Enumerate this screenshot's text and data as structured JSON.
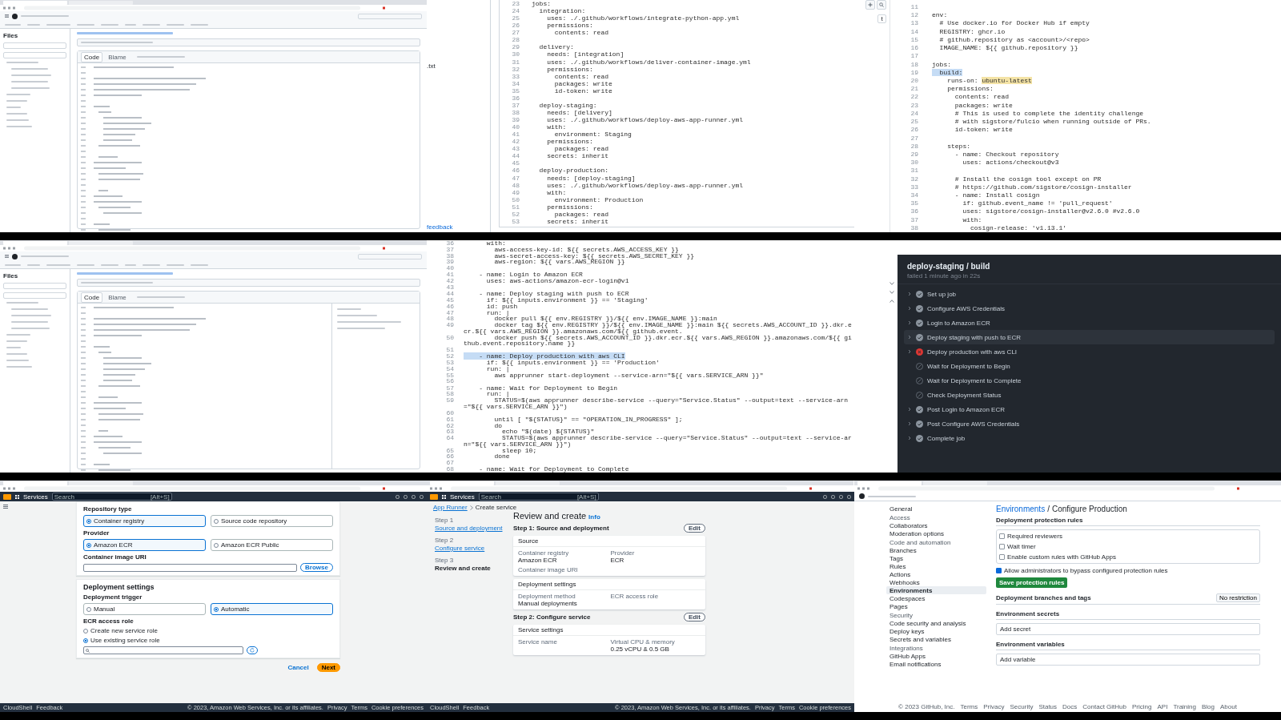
{
  "frames": [
    {
      "kind": "github-file",
      "files_label": "Files",
      "tabs": [
        {
          "label": "Code",
          "selected": true
        },
        {
          "label": "Blame",
          "selected": false
        }
      ],
      "symbols_panel": false
    },
    {
      "kind": "code",
      "sidebar": {
        "kind": "files",
        "texts": [
          ".txt"
        ],
        "link": "feedback"
      },
      "lines": [
        {
          "n": "23",
          "text": "jobs:",
          "selected": false
        },
        {
          "n": "24",
          "text": "  integration:",
          "selected": false
        },
        {
          "n": "25",
          "text": "    uses: ./.github/workflows/integrate-python-app.yml",
          "selected": false
        },
        {
          "n": "26",
          "text": "    permissions:",
          "selected": false
        },
        {
          "n": "27",
          "text": "      contents: read",
          "selected": false
        },
        {
          "n": "28",
          "selected": false
        },
        {
          "n": "29",
          "text": "  delivery:",
          "selected": false
        },
        {
          "n": "30",
          "text": "    needs: [integration]",
          "selected": false
        },
        {
          "n": "31",
          "text": "    uses: ./.github/workflows/deliver-container-image.yml",
          "selected": false
        },
        {
          "n": "32",
          "text": "    permissions:",
          "selected": false
        },
        {
          "n": "33",
          "text": "      contents: read",
          "selected": false
        },
        {
          "n": "34",
          "text": "      packages: write",
          "selected": false
        },
        {
          "n": "35",
          "text": "      id-token: write",
          "selected": false
        },
        {
          "n": "36",
          "selected": false
        },
        {
          "n": "37",
          "text": "  deploy-staging:",
          "selected": false
        },
        {
          "n": "38",
          "text": "    needs: [delivery]",
          "selected": false
        },
        {
          "n": "39",
          "text": "    uses: ./.github/workflows/deploy-aws-app-runner.yml",
          "selected": false
        },
        {
          "n": "40",
          "text": "    with:",
          "selected": false
        },
        {
          "n": "41",
          "text": "      environment: Staging",
          "selected": false
        },
        {
          "n": "42",
          "text": "    permissions:",
          "selected": false
        },
        {
          "n": "43",
          "text": "      packages: read",
          "selected": false
        },
        {
          "n": "44",
          "text": "    secrets: inherit",
          "selected": false
        },
        {
          "n": "45",
          "selected": false
        },
        {
          "n": "46",
          "text": "  deploy-production:",
          "selected": false
        },
        {
          "n": "47",
          "text": "    needs: [deploy-staging]",
          "selected": false
        },
        {
          "n": "48",
          "text": "    uses: ./.github/workflows/deploy-aws-app-runner.yml",
          "selected": false
        },
        {
          "n": "49",
          "text": "    with:",
          "selected": false
        },
        {
          "n": "50",
          "text": "      environment: Production",
          "selected": false
        },
        {
          "n": "51",
          "text": "    permissions:",
          "selected": false
        },
        {
          "n": "52",
          "text": "      packages: read",
          "selected": false
        },
        {
          "n": "53",
          "text": "    secrets: inherit",
          "selected": false
        }
      ]
    },
    {
      "kind": "code",
      "sidebar": {
        "kind": "tools",
        "shortcut": "t"
      },
      "lines": [
        {
          "n": "11",
          "selected": false
        },
        {
          "n": "12",
          "text": "env:",
          "selected": false
        },
        {
          "n": "13",
          "text": "  # Use docker.io for Docker Hub if empty",
          "selected": false
        },
        {
          "n": "14",
          "text": "  REGISTRY: ghcr.io",
          "selected": false
        },
        {
          "n": "15",
          "text": "  # github.repository as <account>/<repo>",
          "selected": false
        },
        {
          "n": "16",
          "text": "  IMAGE_NAME: ${{ github.repository }}",
          "selected": false
        },
        {
          "n": "17",
          "selected": false
        },
        {
          "n": "18",
          "text": "jobs:",
          "selected": false
        },
        {
          "n": "19",
          "text": "  build:",
          "selected": true
        },
        {
          "n": "20",
          "text": "    runs-on: ",
          "mark": "ubuntu-latest",
          "selected": false
        },
        {
          "n": "21",
          "text": "    permissions:",
          "selected": false
        },
        {
          "n": "22",
          "text": "      contents: read",
          "selected": false
        },
        {
          "n": "23",
          "text": "      packages: write",
          "selected": false
        },
        {
          "n": "24",
          "text": "      # This is used to complete the identity challenge",
          "selected": false
        },
        {
          "n": "25",
          "text": "      # with sigstore/fulcio when running outside of PRs.",
          "selected": false
        },
        {
          "n": "26",
          "text": "      id-token: write",
          "selected": false
        },
        {
          "n": "27",
          "selected": false
        },
        {
          "n": "28",
          "text": "    steps:",
          "selected": false
        },
        {
          "n": "29",
          "text": "      - name: Checkout repository",
          "selected": false
        },
        {
          "n": "30",
          "text": "        uses: actions/checkout@v3",
          "selected": false
        },
        {
          "n": "31",
          "selected": false
        },
        {
          "n": "32",
          "text": "      # Install the cosign tool except on PR",
          "selected": false
        },
        {
          "n": "33",
          "text": "      # https://github.com/sigstore/cosign-installer",
          "selected": false
        },
        {
          "n": "34",
          "text": "      - name: Install cosign",
          "selected": false
        },
        {
          "n": "35",
          "text": "        if: github.event_name != 'pull_request'",
          "selected": false
        },
        {
          "n": "36",
          "text": "        uses: sigstore/cosign-installer@v2.6.0 #v2.6.0",
          "selected": false
        },
        {
          "n": "37",
          "text": "        with:",
          "selected": false
        },
        {
          "n": "38",
          "text": "          cosign-release: 'v1.13.1'",
          "selected": false
        }
      ]
    },
    {
      "kind": "github-file",
      "files_label": "Files",
      "tabs": [
        {
          "label": "Code",
          "selected": true
        },
        {
          "label": "Blame",
          "selected": false
        }
      ],
      "symbols_panel": true
    },
    {
      "kind": "code",
      "lines": [
        {
          "n": "36",
          "text": "      with:",
          "selected": false
        },
        {
          "n": "37",
          "text": "        aws-access-key-id: ${{ secrets.AWS_ACCESS_KEY }}",
          "selected": false
        },
        {
          "n": "38",
          "text": "        aws-secret-access-key: ${{ secrets.AWS_SECRET_KEY }}",
          "selected": false
        },
        {
          "n": "39",
          "text": "        aws-region: ${{ vars.AWS_REGION }}",
          "selected": false
        },
        {
          "n": "40",
          "selected": false
        },
        {
          "n": "41",
          "text": "    - name: Login to Amazon ECR",
          "selected": false
        },
        {
          "n": "42",
          "text": "      uses: aws-actions/amazon-ecr-login@v1",
          "selected": false
        },
        {
          "n": "43",
          "selected": false
        },
        {
          "n": "44",
          "text": "    - name: Deploy staging with push to ECR",
          "selected": false
        },
        {
          "n": "45",
          "text": "      if: ${{ inputs.environment }} == 'Staging'",
          "selected": false
        },
        {
          "n": "46",
          "text": "      id: push",
          "selected": false
        },
        {
          "n": "47",
          "text": "      run: |",
          "selected": false
        },
        {
          "n": "48",
          "text": "        docker pull ${{ env.REGISTRY }}/${{ env.IMAGE_NAME }}:main",
          "selected": false
        },
        {
          "n": "49",
          "text": "        docker tag ${{ env.REGISTRY }}/${{ env.IMAGE_NAME }}:main ${{ secrets.AWS_ACCOUNT_ID }}.dkr.ecr.${{ vars.AWS_REGION }}.amazonaws.com/${{ github.event.",
          "selected": false
        },
        {
          "n": "50",
          "text": "        docker push ${{ secrets.AWS_ACCOUNT_ID }}.dkr.ecr.${{ vars.AWS_REGION }}.amazonaws.com/${{ github.event.repository.name }}",
          "selected": false
        },
        {
          "n": "51",
          "selected": false
        },
        {
          "n": "52",
          "text": "    - name: Deploy production with aws CLI",
          "selected": true
        },
        {
          "n": "53",
          "text": "      if: ${{ inputs.environment }} == 'Production'",
          "selected": false
        },
        {
          "n": "54",
          "text": "      run: |",
          "selected": false
        },
        {
          "n": "55",
          "text": "        aws apprunner start-deployment --service-arn=\"${{ vars.SERVICE_ARN }}\"",
          "selected": false
        },
        {
          "n": "56",
          "selected": false
        },
        {
          "n": "57",
          "text": "    - name: Wait for Deployment to Begin",
          "selected": false
        },
        {
          "n": "58",
          "text": "      run: |",
          "selected": false
        },
        {
          "n": "59",
          "text": "        STATUS=$(aws apprunner describe-service --query=\"Service.Status\" --output=text --service-arn=\"${{ vars.SERVICE_ARN }}\")",
          "selected": false
        },
        {
          "n": "60",
          "selected": false
        },
        {
          "n": "61",
          "text": "        until [ \"${STATUS}\" == \"OPERATION_IN_PROGRESS\" ];",
          "selected": false
        },
        {
          "n": "62",
          "text": "        do",
          "selected": false
        },
        {
          "n": "63",
          "text": "          echo \"$(date) ${STATUS}\"",
          "selected": false
        },
        {
          "n": "64",
          "text": "          STATUS=$(aws apprunner describe-service --query=\"Service.Status\" --output=text --service-arn=\"${{ vars.SERVICE_ARN }}\")",
          "selected": false
        },
        {
          "n": "65",
          "text": "          sleep 10;",
          "selected": false
        },
        {
          "n": "66",
          "text": "        done",
          "selected": false
        },
        {
          "n": "67",
          "selected": false
        },
        {
          "n": "68",
          "text": "    - name: Wait for Deployment to Complete",
          "selected": false
        }
      ]
    },
    {
      "kind": "jobs",
      "title": "deploy-staging / build",
      "subtitle": "failed 1 minute ago in 22s",
      "steps": [
        {
          "label": "Set up job",
          "kind": "success",
          "expandable": true,
          "hovered": false
        },
        {
          "label": "Configure AWS Credentials",
          "kind": "success",
          "expandable": true,
          "hovered": false
        },
        {
          "label": "Login to Amazon ECR",
          "kind": "success",
          "expandable": true,
          "hovered": false
        },
        {
          "label": "Deploy staging with push to ECR",
          "kind": "success",
          "expandable": true,
          "hovered": true
        },
        {
          "label": "Deploy production with aws CLI",
          "kind": "failure",
          "expandable": true,
          "hovered": false
        },
        {
          "label": "Wait for Deployment to Begin",
          "kind": "skipped",
          "expandable": false,
          "hovered": false
        },
        {
          "label": "Wait for Deployment to Complete",
          "kind": "skipped",
          "expandable": false,
          "hovered": false
        },
        {
          "label": "Check Deployment Status",
          "kind": "skipped",
          "expandable": false,
          "hovered": false
        },
        {
          "label": "Post Login to Amazon ECR",
          "kind": "success",
          "expandable": true,
          "hovered": false
        },
        {
          "label": "Post Configure AWS Credentials",
          "kind": "success",
          "expandable": true,
          "hovered": false
        },
        {
          "label": "Complete job",
          "kind": "success",
          "expandable": true,
          "hovered": false
        }
      ]
    },
    {
      "kind": "aws-form",
      "nav": {
        "services": "Services",
        "search_placeholder": "Search",
        "shortcut": "[Alt+S]"
      },
      "sections": [
        {
          "fields": [
            {
              "kind": "options",
              "label": "Repository type",
              "options": [
                {
                  "title": "Container registry",
                  "selected": true
                },
                {
                  "title": "Source code repository",
                  "selected": false
                }
              ]
            },
            {
              "kind": "options",
              "label": "Provider",
              "options": [
                {
                  "title": "Amazon ECR",
                  "selected": true
                },
                {
                  "title": "Amazon ECR Public",
                  "selected": false
                }
              ]
            },
            {
              "kind": "input",
              "label": "Container image URI",
              "button": "Browse"
            }
          ]
        },
        {
          "heading": "Deployment settings",
          "fields": [
            {
              "kind": "options",
              "label": "Deployment trigger",
              "options": [
                {
                  "title": "Manual",
                  "selected": false
                },
                {
                  "title": "Automatic",
                  "selected": true
                }
              ]
            },
            {
              "kind": "radios",
              "label": "ECR access role",
              "radios": [
                {
                  "label": "Create new service role",
                  "selected": false
                },
                {
                  "label": "Use existing service role",
                  "selected": true
                }
              ]
            },
            {
              "kind": "search"
            }
          ]
        }
      ],
      "actions": [
        "Cancel",
        "Next"
      ],
      "footer": {
        "left": [
          "CloudShell",
          "Feedback"
        ],
        "right": [
          "© 2023, Amazon Web Services, Inc. or its affiliates.",
          "Privacy",
          "Terms",
          "Cookie preferences"
        ]
      }
    },
    {
      "kind": "aws-review",
      "nav": {
        "services": "Services",
        "search_placeholder": "Search",
        "shortcut": "[Alt+S]"
      },
      "breadcrumbs": [
        "App Runner",
        "Create service"
      ],
      "steps_nav": [
        {
          "step": "Step 1",
          "label": "Source and deployment",
          "selected": false
        },
        {
          "step": "Step 2",
          "label": "Configure service",
          "selected": false
        },
        {
          "step": "Step 3",
          "label": "Review and create",
          "selected": true
        }
      ],
      "title": "Review and create",
      "info": "Info",
      "sections": [
        {
          "heading": "Step 1: Source and deployment",
          "edit": "Edit",
          "cards": [
            {
              "title": "Source",
              "fields": [
                {
                  "label": "Container registry",
                  "value": "Amazon ECR"
                },
                {
                  "label": "Provider",
                  "value": "ECR"
                },
                {
                  "label": "Container image URI"
                }
              ]
            },
            {
              "title": "Deployment settings",
              "fields": [
                {
                  "label": "Deployment method",
                  "value": "Manual deployments"
                },
                {
                  "label": "ECR access role"
                }
              ]
            }
          ]
        },
        {
          "heading": "Step 2: Configure service",
          "edit": "Edit",
          "cards": [
            {
              "title": "Service settings",
              "fields": [
                {
                  "label": "Service name"
                },
                {
                  "label": "Virtual CPU & memory",
                  "value": "0.25 vCPU & 0.5 GB"
                }
              ]
            }
          ]
        }
      ],
      "footer": {
        "left": [
          "CloudShell",
          "Feedback"
        ],
        "right": [
          "© 2023, Amazon Web Services, Inc. or its affiliates.",
          "Privacy",
          "Terms",
          "Cookie preferences"
        ]
      }
    },
    {
      "kind": "github-settings",
      "sidebar": [
        {
          "kind": "item",
          "label": "General",
          "selected": false
        },
        {
          "kind": "heading",
          "label": "Access"
        },
        {
          "kind": "item",
          "label": "Collaborators",
          "selected": false
        },
        {
          "kind": "item",
          "label": "Moderation options",
          "selected": false
        },
        {
          "kind": "heading",
          "label": "Code and automation"
        },
        {
          "kind": "item",
          "label": "Branches",
          "selected": false
        },
        {
          "kind": "item",
          "label": "Tags",
          "selected": false
        },
        {
          "kind": "item",
          "label": "Rules",
          "selected": false
        },
        {
          "kind": "item",
          "label": "Actions",
          "selected": false
        },
        {
          "kind": "item",
          "label": "Webhooks",
          "selected": false
        },
        {
          "kind": "item",
          "label": "Environments",
          "selected": true
        },
        {
          "kind": "item",
          "label": "Codespaces",
          "selected": false
        },
        {
          "kind": "item",
          "label": "Pages",
          "selected": false
        },
        {
          "kind": "heading",
          "label": "Security"
        },
        {
          "kind": "item",
          "label": "Code security and analysis",
          "selected": false
        },
        {
          "kind": "item",
          "label": "Deploy keys",
          "selected": false
        },
        {
          "kind": "item",
          "label": "Secrets and variables",
          "selected": false
        },
        {
          "kind": "heading",
          "label": "Integrations"
        },
        {
          "kind": "item",
          "label": "GitHub Apps",
          "selected": false
        },
        {
          "kind": "item",
          "label": "Email notifications",
          "selected": false
        }
      ],
      "breadcrumb": {
        "parent": "Environments",
        "separator": "/",
        "current": "Configure Production"
      },
      "protection": {
        "heading": "Deployment protection rules",
        "rules": [
          {
            "label": "Required reviewers",
            "checked": false
          },
          {
            "label": "Wait timer",
            "checked": false
          },
          {
            "label": "Enable custom rules with GitHub Apps",
            "checked": false
          },
          {
            "label": "Allow administrators to bypass configured protection rules",
            "checked": true
          }
        ],
        "button": "Save protection rules"
      },
      "sections": [
        {
          "heading": "Deployment branches and tags",
          "dropdown": "No restriction"
        },
        {
          "heading": "Environment secrets",
          "add": "Add secret"
        },
        {
          "heading": "Environment variables",
          "add": "Add variable"
        }
      ],
      "footer": [
        "© 2023 GitHub, Inc.",
        "Terms",
        "Privacy",
        "Security",
        "Status",
        "Docs",
        "Contact GitHub",
        "Pricing",
        "API",
        "Training",
        "Blog",
        "About"
      ]
    }
  ]
}
